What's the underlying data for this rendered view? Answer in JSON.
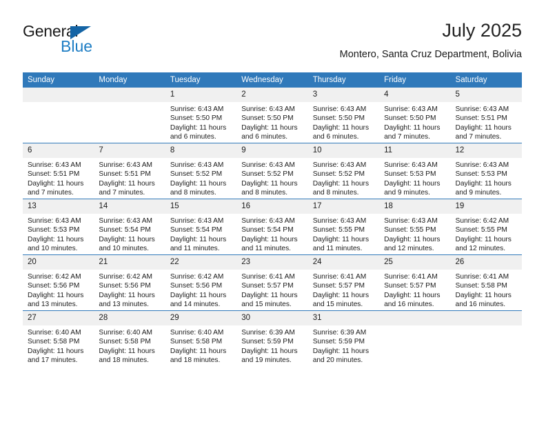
{
  "brand": {
    "name_part1": "General",
    "name_part2": "Blue",
    "triangle_color": "#1464a5",
    "blue_color": "#1d7dc4"
  },
  "header": {
    "title": "July 2025",
    "subtitle": "Montero, Santa Cruz Department, Bolivia",
    "header_bg": "#3079ba",
    "daynum_bg": "#f0f0f0"
  },
  "weekdays": [
    "Sunday",
    "Monday",
    "Tuesday",
    "Wednesday",
    "Thursday",
    "Friday",
    "Saturday"
  ],
  "weeks": [
    [
      {
        "day": "",
        "sunrise": "",
        "sunset": "",
        "daylight1": "",
        "daylight2": ""
      },
      {
        "day": "",
        "sunrise": "",
        "sunset": "",
        "daylight1": "",
        "daylight2": ""
      },
      {
        "day": "1",
        "sunrise": "Sunrise: 6:43 AM",
        "sunset": "Sunset: 5:50 PM",
        "daylight1": "Daylight: 11 hours",
        "daylight2": "and 6 minutes."
      },
      {
        "day": "2",
        "sunrise": "Sunrise: 6:43 AM",
        "sunset": "Sunset: 5:50 PM",
        "daylight1": "Daylight: 11 hours",
        "daylight2": "and 6 minutes."
      },
      {
        "day": "3",
        "sunrise": "Sunrise: 6:43 AM",
        "sunset": "Sunset: 5:50 PM",
        "daylight1": "Daylight: 11 hours",
        "daylight2": "and 6 minutes."
      },
      {
        "day": "4",
        "sunrise": "Sunrise: 6:43 AM",
        "sunset": "Sunset: 5:50 PM",
        "daylight1": "Daylight: 11 hours",
        "daylight2": "and 7 minutes."
      },
      {
        "day": "5",
        "sunrise": "Sunrise: 6:43 AM",
        "sunset": "Sunset: 5:51 PM",
        "daylight1": "Daylight: 11 hours",
        "daylight2": "and 7 minutes."
      }
    ],
    [
      {
        "day": "6",
        "sunrise": "Sunrise: 6:43 AM",
        "sunset": "Sunset: 5:51 PM",
        "daylight1": "Daylight: 11 hours",
        "daylight2": "and 7 minutes."
      },
      {
        "day": "7",
        "sunrise": "Sunrise: 6:43 AM",
        "sunset": "Sunset: 5:51 PM",
        "daylight1": "Daylight: 11 hours",
        "daylight2": "and 7 minutes."
      },
      {
        "day": "8",
        "sunrise": "Sunrise: 6:43 AM",
        "sunset": "Sunset: 5:52 PM",
        "daylight1": "Daylight: 11 hours",
        "daylight2": "and 8 minutes."
      },
      {
        "day": "9",
        "sunrise": "Sunrise: 6:43 AM",
        "sunset": "Sunset: 5:52 PM",
        "daylight1": "Daylight: 11 hours",
        "daylight2": "and 8 minutes."
      },
      {
        "day": "10",
        "sunrise": "Sunrise: 6:43 AM",
        "sunset": "Sunset: 5:52 PM",
        "daylight1": "Daylight: 11 hours",
        "daylight2": "and 8 minutes."
      },
      {
        "day": "11",
        "sunrise": "Sunrise: 6:43 AM",
        "sunset": "Sunset: 5:53 PM",
        "daylight1": "Daylight: 11 hours",
        "daylight2": "and 9 minutes."
      },
      {
        "day": "12",
        "sunrise": "Sunrise: 6:43 AM",
        "sunset": "Sunset: 5:53 PM",
        "daylight1": "Daylight: 11 hours",
        "daylight2": "and 9 minutes."
      }
    ],
    [
      {
        "day": "13",
        "sunrise": "Sunrise: 6:43 AM",
        "sunset": "Sunset: 5:53 PM",
        "daylight1": "Daylight: 11 hours",
        "daylight2": "and 10 minutes."
      },
      {
        "day": "14",
        "sunrise": "Sunrise: 6:43 AM",
        "sunset": "Sunset: 5:54 PM",
        "daylight1": "Daylight: 11 hours",
        "daylight2": "and 10 minutes."
      },
      {
        "day": "15",
        "sunrise": "Sunrise: 6:43 AM",
        "sunset": "Sunset: 5:54 PM",
        "daylight1": "Daylight: 11 hours",
        "daylight2": "and 11 minutes."
      },
      {
        "day": "16",
        "sunrise": "Sunrise: 6:43 AM",
        "sunset": "Sunset: 5:54 PM",
        "daylight1": "Daylight: 11 hours",
        "daylight2": "and 11 minutes."
      },
      {
        "day": "17",
        "sunrise": "Sunrise: 6:43 AM",
        "sunset": "Sunset: 5:55 PM",
        "daylight1": "Daylight: 11 hours",
        "daylight2": "and 11 minutes."
      },
      {
        "day": "18",
        "sunrise": "Sunrise: 6:43 AM",
        "sunset": "Sunset: 5:55 PM",
        "daylight1": "Daylight: 11 hours",
        "daylight2": "and 12 minutes."
      },
      {
        "day": "19",
        "sunrise": "Sunrise: 6:42 AM",
        "sunset": "Sunset: 5:55 PM",
        "daylight1": "Daylight: 11 hours",
        "daylight2": "and 12 minutes."
      }
    ],
    [
      {
        "day": "20",
        "sunrise": "Sunrise: 6:42 AM",
        "sunset": "Sunset: 5:56 PM",
        "daylight1": "Daylight: 11 hours",
        "daylight2": "and 13 minutes."
      },
      {
        "day": "21",
        "sunrise": "Sunrise: 6:42 AM",
        "sunset": "Sunset: 5:56 PM",
        "daylight1": "Daylight: 11 hours",
        "daylight2": "and 13 minutes."
      },
      {
        "day": "22",
        "sunrise": "Sunrise: 6:42 AM",
        "sunset": "Sunset: 5:56 PM",
        "daylight1": "Daylight: 11 hours",
        "daylight2": "and 14 minutes."
      },
      {
        "day": "23",
        "sunrise": "Sunrise: 6:41 AM",
        "sunset": "Sunset: 5:57 PM",
        "daylight1": "Daylight: 11 hours",
        "daylight2": "and 15 minutes."
      },
      {
        "day": "24",
        "sunrise": "Sunrise: 6:41 AM",
        "sunset": "Sunset: 5:57 PM",
        "daylight1": "Daylight: 11 hours",
        "daylight2": "and 15 minutes."
      },
      {
        "day": "25",
        "sunrise": "Sunrise: 6:41 AM",
        "sunset": "Sunset: 5:57 PM",
        "daylight1": "Daylight: 11 hours",
        "daylight2": "and 16 minutes."
      },
      {
        "day": "26",
        "sunrise": "Sunrise: 6:41 AM",
        "sunset": "Sunset: 5:58 PM",
        "daylight1": "Daylight: 11 hours",
        "daylight2": "and 16 minutes."
      }
    ],
    [
      {
        "day": "27",
        "sunrise": "Sunrise: 6:40 AM",
        "sunset": "Sunset: 5:58 PM",
        "daylight1": "Daylight: 11 hours",
        "daylight2": "and 17 minutes."
      },
      {
        "day": "28",
        "sunrise": "Sunrise: 6:40 AM",
        "sunset": "Sunset: 5:58 PM",
        "daylight1": "Daylight: 11 hours",
        "daylight2": "and 18 minutes."
      },
      {
        "day": "29",
        "sunrise": "Sunrise: 6:40 AM",
        "sunset": "Sunset: 5:58 PM",
        "daylight1": "Daylight: 11 hours",
        "daylight2": "and 18 minutes."
      },
      {
        "day": "30",
        "sunrise": "Sunrise: 6:39 AM",
        "sunset": "Sunset: 5:59 PM",
        "daylight1": "Daylight: 11 hours",
        "daylight2": "and 19 minutes."
      },
      {
        "day": "31",
        "sunrise": "Sunrise: 6:39 AM",
        "sunset": "Sunset: 5:59 PM",
        "daylight1": "Daylight: 11 hours",
        "daylight2": "and 20 minutes."
      },
      {
        "day": "",
        "sunrise": "",
        "sunset": "",
        "daylight1": "",
        "daylight2": ""
      },
      {
        "day": "",
        "sunrise": "",
        "sunset": "",
        "daylight1": "",
        "daylight2": ""
      }
    ]
  ]
}
